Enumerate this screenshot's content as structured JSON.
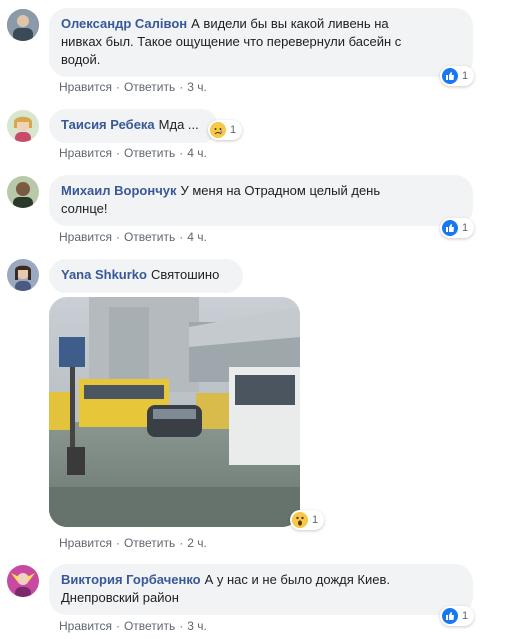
{
  "actions": {
    "like": "Нравится",
    "reply": "Ответить",
    "sep": "·"
  },
  "comments": [
    {
      "author": "Олександр Салівон",
      "text_line1": "А видели бы вы какой ливень на",
      "text_line2": "нивках был. Такое ощущение что перевернули басейн с",
      "text_line3": "водой.",
      "time": "3 ч.",
      "reaction": "like-icon",
      "reaction_count": "1"
    },
    {
      "author": "Таисия Ребека",
      "text": "Мда ...",
      "time": "4 ч.",
      "reaction": "sad-icon",
      "reaction_count": "1"
    },
    {
      "author": "Михаил Ворончук",
      "text_line1": "У меня на Отрадном целый день",
      "text_line2": "солнце!",
      "time": "4 ч.",
      "reaction": "like-icon",
      "reaction_count": "1"
    },
    {
      "author": "Yana Shkurko",
      "text": "Святошино",
      "time": "2 ч.",
      "reaction": "wow-icon",
      "reaction_count": "1"
    },
    {
      "author": "Виктория Горбаченко",
      "text_line1": "А у нас и не было дождя Киев.",
      "text_line2": "Днепровский район",
      "time": "3 ч.",
      "reaction": "like-icon",
      "reaction_count": "1"
    }
  ],
  "colors": {
    "author": "#385898",
    "bubble": "#f2f3f5",
    "like": "#1877f2",
    "meta": "#606770"
  }
}
